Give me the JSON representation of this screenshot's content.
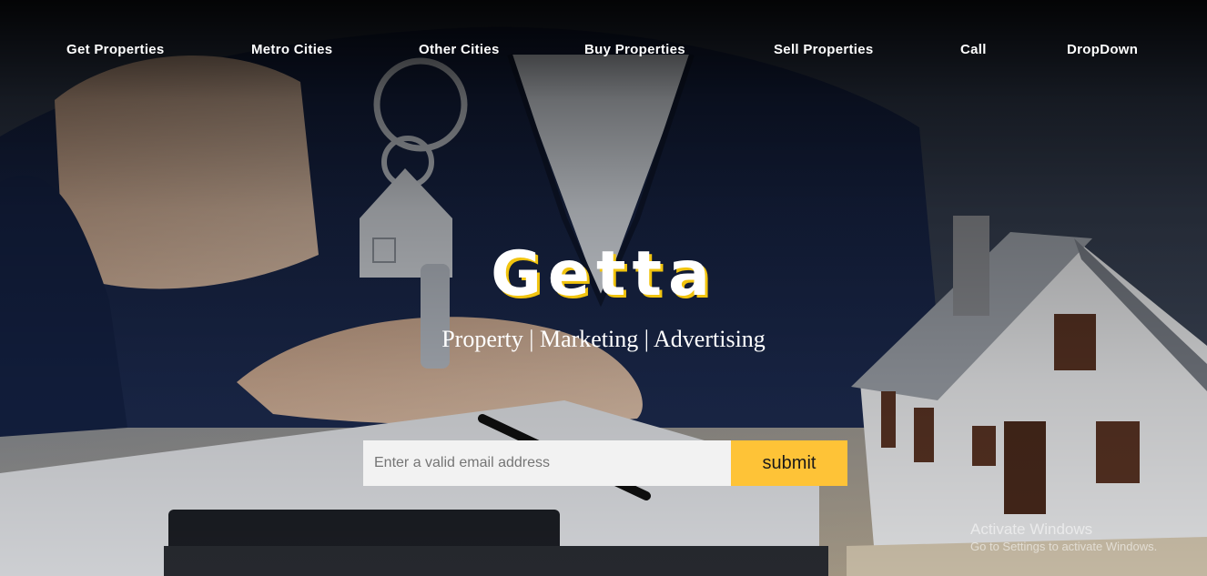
{
  "nav": {
    "items": [
      {
        "label": "Get Properties"
      },
      {
        "label": "Metro Cities"
      },
      {
        "label": "Other Cities"
      },
      {
        "label": "Buy Properties"
      },
      {
        "label": "Sell Properties"
      },
      {
        "label": "Call"
      },
      {
        "label": "DropDown"
      }
    ]
  },
  "hero": {
    "brand": "Getta",
    "tagline": "Property | Marketing | Advertising",
    "background": "hands-holding-house-keys-and-model-house-photo"
  },
  "signup": {
    "placeholder": "Enter a valid email address",
    "email_value": "",
    "submit_label": "submit"
  },
  "watermark": {
    "title": "Activate Windows",
    "subtitle": "Go to Settings to activate Windows."
  },
  "colors": {
    "accent": "#fec337",
    "brand_shadow": "#f1c40f",
    "input_bg": "#f2f2f2",
    "nav_text": "#ffffff"
  }
}
